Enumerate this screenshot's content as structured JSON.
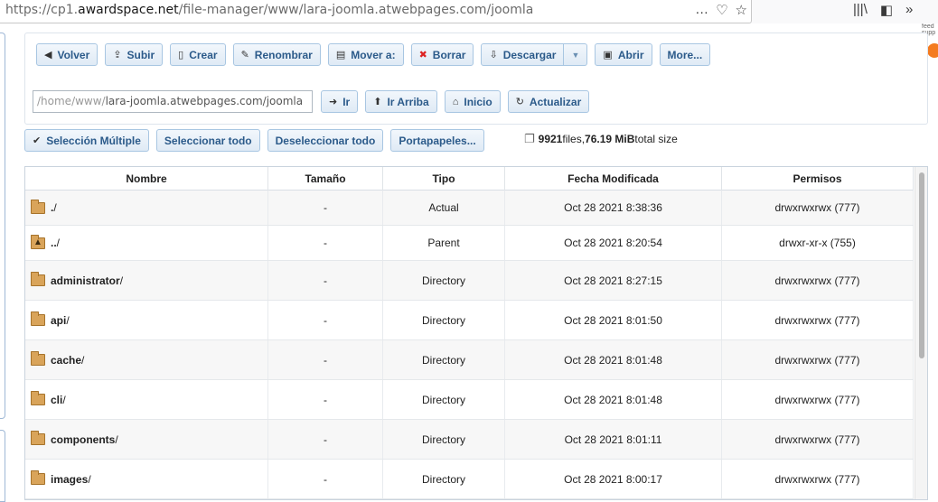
{
  "browser": {
    "url_prefix": "https://cp1.",
    "url_host": "awardspace.net",
    "url_path": "/file-manager/www/lara-joomla.atwebpages.com/joomla",
    "more_icon": "…",
    "pocket_icon": "♡",
    "bookmark_icon": "☆",
    "library_icon": "|||\\",
    "sidebar_icon": "◧",
    "overflow_icon": "»"
  },
  "side_widget": {
    "text": "feed supp"
  },
  "toolbar": {
    "back": "Volver",
    "upload": "Subir",
    "create": "Crear",
    "rename": "Renombrar",
    "move": "Mover a:",
    "delete": "Borrar",
    "download": "Descargar",
    "open": "Abrir",
    "more": "More..."
  },
  "path": {
    "prefix": "/home/www/",
    "value": "lara-joomla.atwebpages.com/joomla",
    "go": "Ir",
    "up": "Ir Arriba",
    "home": "Inicio",
    "refresh": "Actualizar"
  },
  "selection": {
    "multi": "Selección Múltiple",
    "select_all": "Seleccionar todo",
    "deselect_all": "Deseleccionar todo",
    "clipboard": "Portapapeles..."
  },
  "stats": {
    "files_count": "9921",
    "files_label": " files, ",
    "size": "76.19 MiB",
    "size_label": " total size"
  },
  "table": {
    "headers": [
      "Nombre",
      "Tamaño",
      "Tipo",
      "Fecha Modificada",
      "Permisos"
    ],
    "rows": [
      {
        "name": ".",
        "slash": "/",
        "size": "-",
        "type": "Actual",
        "date": "Oct 28 2021 8:38:36",
        "perms": "drwxrwxrwx (777)",
        "icon": "folder-icon"
      },
      {
        "name": "..",
        "slash": "/",
        "size": "-",
        "type": "Parent",
        "date": "Oct 28 2021 8:20:54",
        "perms": "drwxr-xr-x (755)",
        "icon": "parent-folder-icon"
      },
      {
        "name": "administrator",
        "slash": "/",
        "size": "-",
        "type": "Directory",
        "date": "Oct 28 2021 8:27:15",
        "perms": "drwxrwxrwx (777)",
        "icon": "folder-icon"
      },
      {
        "name": "api",
        "slash": "/",
        "size": "-",
        "type": "Directory",
        "date": "Oct 28 2021 8:01:50",
        "perms": "drwxrwxrwx (777)",
        "icon": "folder-icon"
      },
      {
        "name": "cache",
        "slash": "/",
        "size": "-",
        "type": "Directory",
        "date": "Oct 28 2021 8:01:48",
        "perms": "drwxrwxrwx (777)",
        "icon": "folder-icon"
      },
      {
        "name": "cli",
        "slash": "/",
        "size": "-",
        "type": "Directory",
        "date": "Oct 28 2021 8:01:48",
        "perms": "drwxrwxrwx (777)",
        "icon": "folder-icon"
      },
      {
        "name": "components",
        "slash": "/",
        "size": "-",
        "type": "Directory",
        "date": "Oct 28 2021 8:01:11",
        "perms": "drwxrwxrwx (777)",
        "icon": "folder-icon"
      },
      {
        "name": "images",
        "slash": "/",
        "size": "-",
        "type": "Directory",
        "date": "Oct 28 2021 8:00:17",
        "perms": "drwxrwxrwx (777)",
        "icon": "folder-icon"
      }
    ]
  },
  "colors": {
    "button_text": "#2b5a8a",
    "button_border": "#a8c6e2",
    "folder": "#d9a45a",
    "delete_icon": "#dd2222"
  }
}
